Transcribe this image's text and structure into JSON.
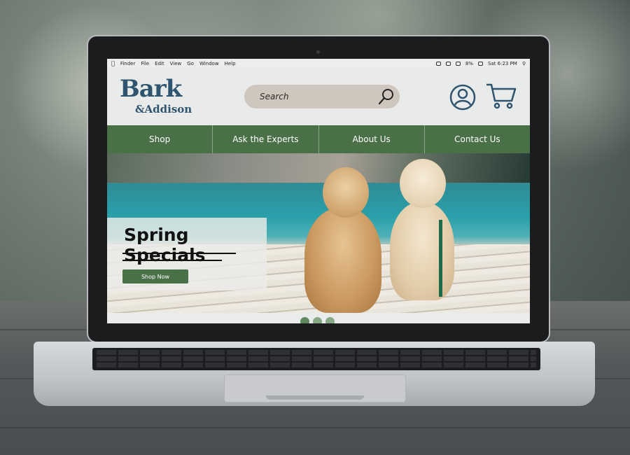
{
  "menubar": {
    "apple": "",
    "items": [
      "Finder",
      "File",
      "Edit",
      "View",
      "Go",
      "Window",
      "Help"
    ],
    "battery": "8%",
    "datetime": "Sat 6:23 PM"
  },
  "brand": {
    "name_main": "Bark",
    "name_sub": "&Addison",
    "color": "#2f5470"
  },
  "search": {
    "placeholder": "Search"
  },
  "header_icons": [
    "user-icon",
    "cart-icon",
    "search-icon"
  ],
  "nav": {
    "items": [
      {
        "label": "Shop"
      },
      {
        "label": "Ask the Experts"
      },
      {
        "label": "About Us"
      },
      {
        "label": "Contact Us"
      }
    ],
    "color": "#4a7047"
  },
  "hero": {
    "title": "Spring Specials",
    "cta": "Shop Now"
  },
  "carousel": {
    "count": 3,
    "active": 0
  }
}
